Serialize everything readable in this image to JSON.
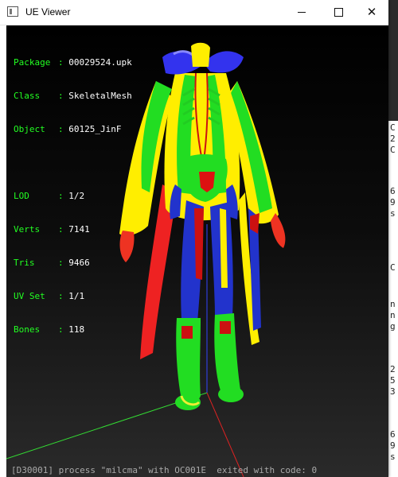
{
  "window": {
    "title": "UE Viewer"
  },
  "info": {
    "rows": [
      {
        "key": "Package",
        "value": "00029524.upk"
      },
      {
        "key": "Class",
        "value": "SkeletalMesh"
      },
      {
        "key": "Object",
        "value": "60125_JinF"
      }
    ],
    "stats": [
      {
        "key": "LOD",
        "value": "1/2"
      },
      {
        "key": "Verts",
        "value": "7141"
      },
      {
        "key": "Tris",
        "value": "9466"
      },
      {
        "key": "UV Set",
        "value": "1/1"
      },
      {
        "key": "Bones",
        "value": "118"
      }
    ]
  },
  "console": {
    "bottom_line": "[D30001] process \"milcma\" with OC001E  exited with code: 0",
    "right_chars": [
      "C",
      "2",
      "C",
      "6",
      "9",
      "s",
      "C",
      "n",
      "n",
      "g",
      "2",
      "5",
      "3",
      "6",
      "9",
      "s"
    ]
  },
  "colors": {
    "accent_label": "#22ff22",
    "viewport_top": "#000000",
    "viewport_bottom": "#2a2a2a"
  }
}
